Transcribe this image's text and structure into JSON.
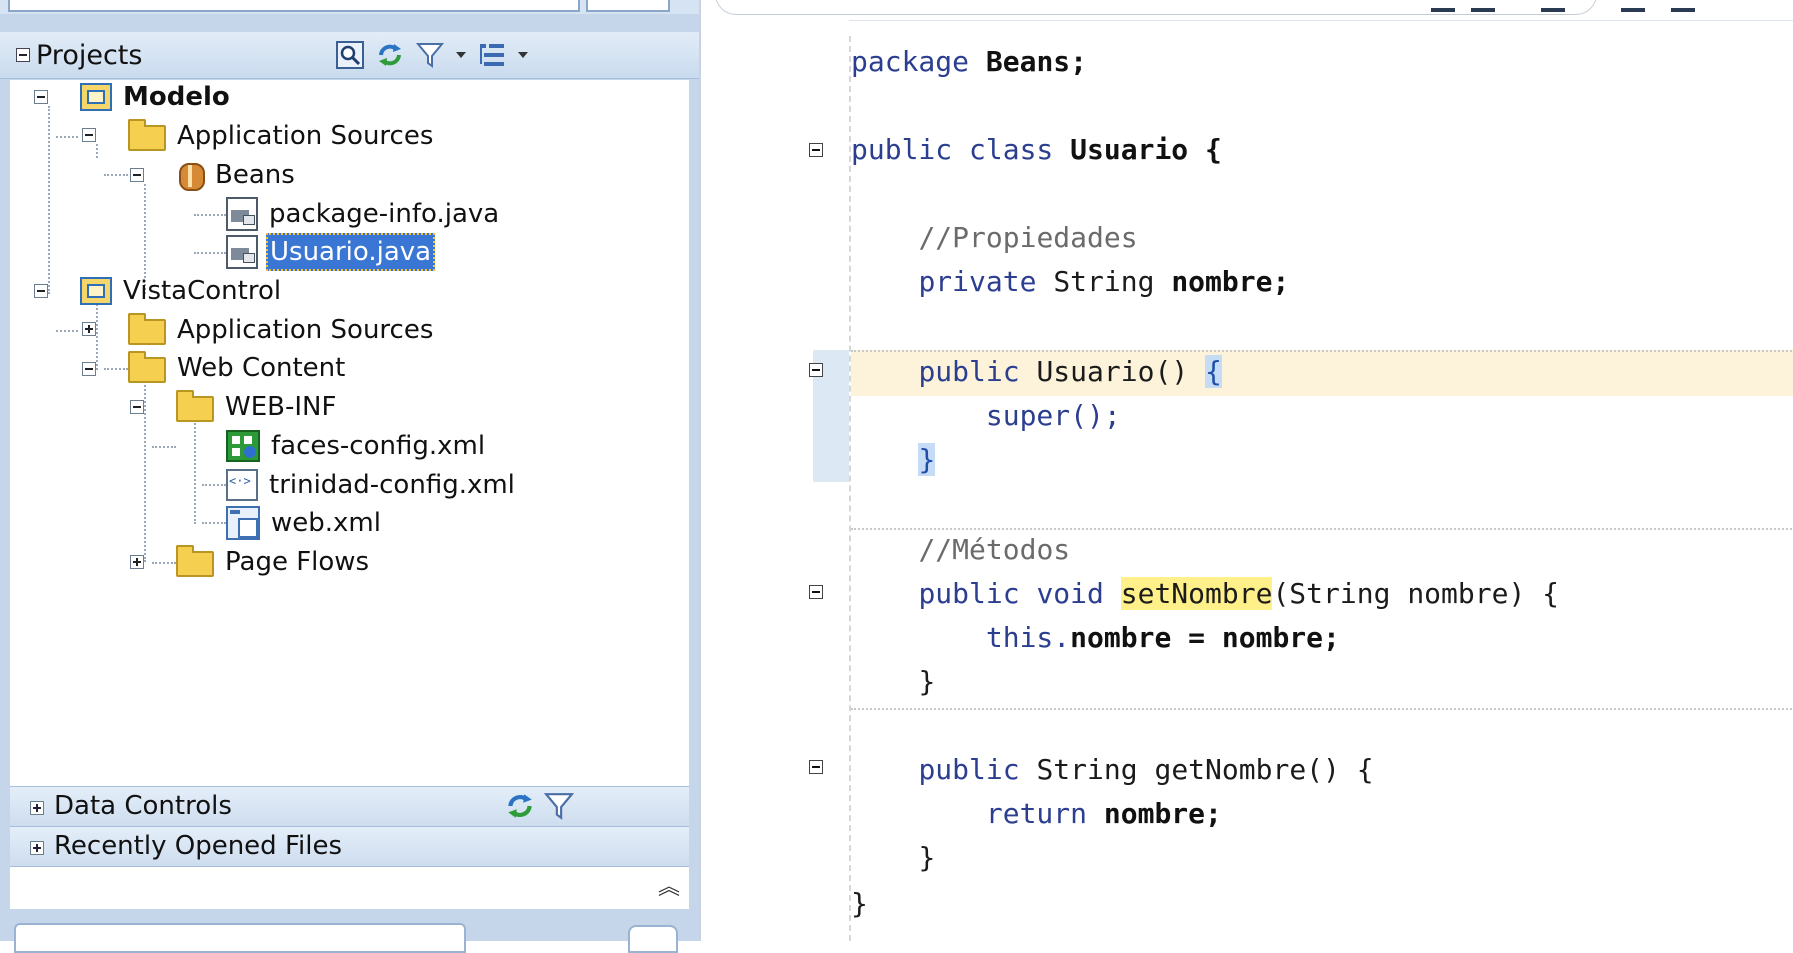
{
  "projects_panel": {
    "title": "Projects",
    "tools": [
      "search-icon",
      "refresh-icon",
      "filter-icon",
      "layout-icon"
    ],
    "tree": [
      {
        "label": "Modelo",
        "icon": "project-icon",
        "bold": true
      },
      {
        "label": "Application Sources",
        "icon": "folder-icon"
      },
      {
        "label": "Beans",
        "icon": "package-icon"
      },
      {
        "label": "package-info.java",
        "icon": "java-file-icon"
      },
      {
        "label": "Usuario.java",
        "icon": "java-file-icon",
        "selected": true
      },
      {
        "label": "VistaControl",
        "icon": "project-icon"
      },
      {
        "label": "Application Sources",
        "icon": "folder-icon",
        "collapsed": true
      },
      {
        "label": "Web Content",
        "icon": "folder-icon"
      },
      {
        "label": "WEB-INF",
        "icon": "folder-icon"
      },
      {
        "label": "faces-config.xml",
        "icon": "faces-config-icon"
      },
      {
        "label": "trinidad-config.xml",
        "icon": "xml-file-icon"
      },
      {
        "label": "web.xml",
        "icon": "web-xml-icon"
      },
      {
        "label": "Page Flows",
        "icon": "folder-icon",
        "collapsed": true
      }
    ]
  },
  "data_controls": {
    "title": "Data Controls"
  },
  "recent_files": {
    "title": "Recently Opened Files"
  },
  "editor": {
    "lines": [
      {
        "text": "package Beans;"
      },
      {
        "text": "public class Usuario {"
      },
      {
        "text": "//Propiedades"
      },
      {
        "text": "private String nombre;"
      },
      {
        "text": "public Usuario() {"
      },
      {
        "text": "super();"
      },
      {
        "text": "}"
      },
      {
        "text": "//Métodos"
      },
      {
        "text": "public void setNombre(String nombre) {"
      },
      {
        "text": "this.nombre = nombre;"
      },
      {
        "text": "}"
      },
      {
        "text": "public String getNombre() {"
      },
      {
        "text": "return nombre;"
      },
      {
        "text": "}"
      },
      {
        "text": "}"
      }
    ],
    "tokens": {
      "l1_kw": "package",
      "l1_name": "Beans;",
      "l2_kw": "public class",
      "l2_name": "Usuario {",
      "l3": "//Propiedades",
      "l4_kw": "private",
      "l4_type": "String",
      "l4_name": "nombre;",
      "l5_kw": "public",
      "l5_name": "Usuario()",
      "l5_brace": "{",
      "l6": "super();",
      "l7": "}",
      "l8": "//Métodos",
      "l9_kw": "public void",
      "l9_method": "setNombre",
      "l9_rest": "(String nombre) {",
      "l10_kw": "this.",
      "l10_rest": "nombre = nombre;",
      "l11": "}",
      "l12_kw": "public",
      "l12_rest": "String getNombre() {",
      "l13_kw": "return",
      "l13_rest": "nombre;",
      "l14": "}",
      "l15": "}"
    }
  },
  "colors": {
    "panel_bg": "#c5d6eb",
    "selection": "#3a76d4",
    "keyword": "#2c3e90",
    "current_line": "#fdf3da",
    "search_highlight": "#fff08a"
  }
}
